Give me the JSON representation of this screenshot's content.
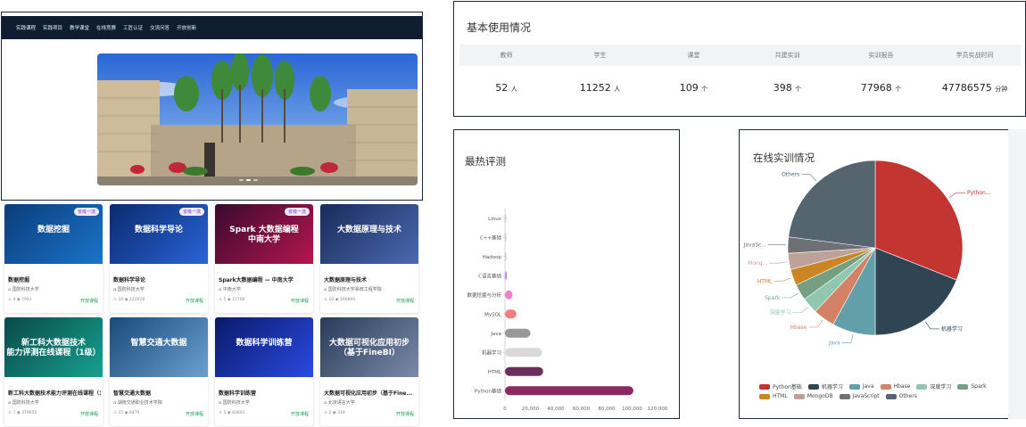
{
  "site": {
    "nav": [
      "实践课程",
      "实践项目",
      "教学课堂",
      "在线竞赛",
      "工匠认证",
      "交流问答",
      "开放创新"
    ]
  },
  "courses": [
    {
      "thumb_title": "数据挖掘",
      "badge": "省级一流",
      "name": "数据挖掘",
      "school": "国防科技大学",
      "learners": "4",
      "views": "7941",
      "open": "开放课程",
      "colors": [
        "#0b3d7a",
        "#1a73c9"
      ]
    },
    {
      "thumb_title": "数据科学导论",
      "badge": "省级一流",
      "name": "数据科学导论",
      "school": "国防科技大学",
      "learners": "10",
      "views": "222678",
      "open": "开放课程",
      "colors": [
        "#0a2a6e",
        "#2b64d6"
      ]
    },
    {
      "thumb_title": "Spark 大数据编程\n中南大学",
      "badge": "省级一流",
      "name": "Spark大数据编程 — 中南大学",
      "school": "中南大学",
      "learners": "5",
      "views": "15766",
      "open": "开放课程",
      "colors": [
        "#3a0a2e",
        "#b3164f"
      ]
    },
    {
      "thumb_title": "大数据原理与技术",
      "badge": "",
      "name": "大数据原理与技术",
      "school": "国防科技大学系统工程学院",
      "learners": "10",
      "views": "166694",
      "open": "开放课程",
      "colors": [
        "#1a2a5a",
        "#4a6ab0"
      ]
    },
    {
      "thumb_title": "新工科大数据技术\n能力评测在线课程（1级）",
      "badge": "",
      "name": "新工科大数据技术能力评测在线课程（1级）",
      "school": "国防科技大学",
      "learners": "7",
      "views": "379655",
      "open": "开放课程",
      "colors": [
        "#0a4a4a",
        "#17a08f"
      ]
    },
    {
      "thumb_title": "智慧交通大数据",
      "badge": "",
      "name": "智慧交通大数据",
      "school": "湖南交通职业技术学院",
      "learners": "15",
      "views": "6479",
      "open": "开放课程",
      "colors": [
        "#1a4a7a",
        "#6aa0d0"
      ]
    },
    {
      "thumb_title": "数据科学训练营",
      "badge": "",
      "name": "数据科学训练营",
      "school": "国防科技大学",
      "learners": "5",
      "views": "83601",
      "open": "开放课程",
      "colors": [
        "#0a1a6a",
        "#2a4ae0"
      ]
    },
    {
      "thumb_title": "大数据可视化应用初步\n（基于FineBI）",
      "badge": "",
      "name": "大数据可视化应用初步（基于Fine...",
      "school": "北京语言大学",
      "learners": "2",
      "views": "318",
      "open": "开放课程",
      "colors": [
        "#2a3a5a",
        "#7a8aa8"
      ]
    }
  ],
  "usage": {
    "title": "基本使用情况",
    "columns": [
      {
        "label": "教师",
        "value": "52",
        "unit": "人"
      },
      {
        "label": "学生",
        "value": "11252",
        "unit": "人"
      },
      {
        "label": "课堂",
        "value": "109",
        "unit": "个"
      },
      {
        "label": "共建实训",
        "value": "398",
        "unit": "个"
      },
      {
        "label": "实训报告",
        "value": "77968",
        "unit": "个"
      },
      {
        "label": "学员实战时间",
        "value": "47786575",
        "unit": "分钟"
      }
    ]
  },
  "hot": {
    "title": "最热评测"
  },
  "train": {
    "title": "在线实训情况"
  },
  "chart_data": [
    {
      "type": "bar",
      "orientation": "horizontal",
      "title": "最热评测",
      "categories": [
        "Python基础",
        "HTML",
        "机器学习",
        "Java",
        "MySQL",
        "数据挖掘与分析",
        "C语言基础",
        "Hadoop",
        "C++基础",
        "Linux"
      ],
      "values": [
        101000,
        30000,
        29000,
        20000,
        9000,
        6000,
        1500,
        400,
        300,
        200
      ],
      "colors": [
        "#8e2a63",
        "#6b2f5c",
        "#d9d9d9",
        "#999999",
        "#f08080",
        "#ee82c8",
        "#c08be0",
        "#cccccc",
        "#cccccc",
        "#cccccc"
      ],
      "xlim": [
        0,
        120000
      ],
      "xticks": [
        "0",
        "20,000",
        "40,000",
        "60,000",
        "80,000",
        "100,000",
        "120,000"
      ]
    },
    {
      "type": "pie",
      "title": "在线实训情况",
      "labels": [
        "Python基础",
        "机器学习",
        "Java",
        "Hbase",
        "深度学习",
        "Spark",
        "HTML",
        "MongoDB",
        "JavaScript",
        "Others"
      ],
      "slice_labels": [
        "Python...",
        "机器学习",
        "Java",
        "Hbase",
        "深度学习",
        "Spark",
        "HTML",
        "Mong...",
        "JavaSc...",
        "Others"
      ],
      "values": [
        31,
        19,
        8,
        4,
        3,
        3,
        3,
        3,
        3,
        23
      ],
      "colors": [
        "#c23531",
        "#2f4554",
        "#61a0a8",
        "#d48265",
        "#91c7ae",
        "#749f83",
        "#ca8622",
        "#bda29a",
        "#6e7074",
        "#546570"
      ],
      "legend": "bottom"
    }
  ]
}
